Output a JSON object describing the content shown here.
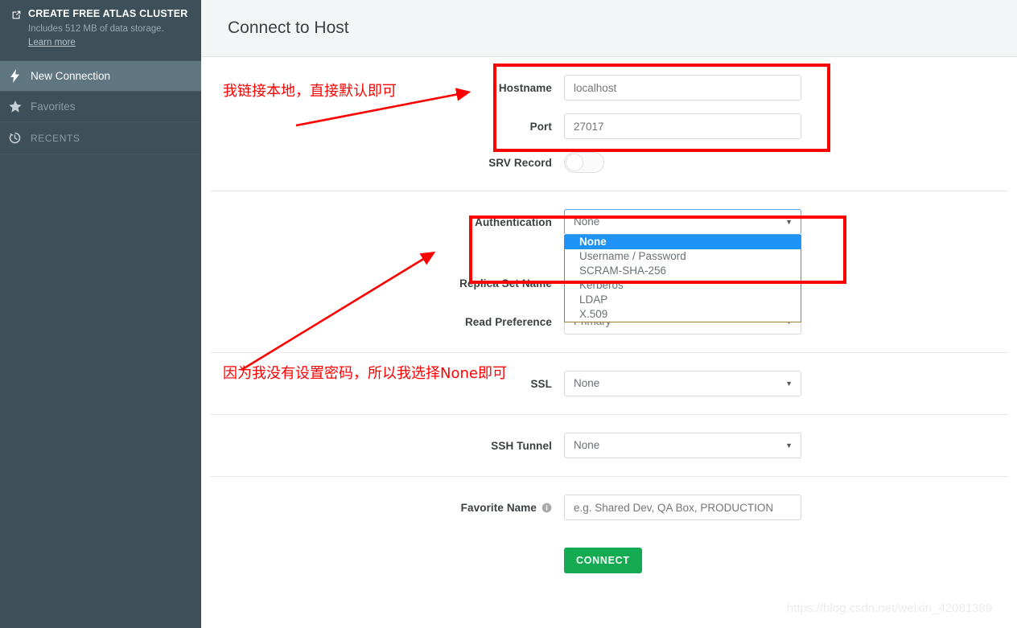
{
  "sidebar": {
    "promo": {
      "icon": "external-link-icon",
      "title": "CREATE FREE ATLAS CLUSTER",
      "subtitle": "Includes 512 MB of data storage.",
      "link": "Learn more"
    },
    "items": [
      {
        "icon": "lightning-bolt-icon",
        "label": "New Connection",
        "active": true
      },
      {
        "icon": "star-icon",
        "label": "Favorites",
        "active": false
      },
      {
        "icon": "history-clock-icon",
        "label": "RECENTS",
        "active": false
      }
    ]
  },
  "header": {
    "title": "Connect to Host"
  },
  "form": {
    "hostname": {
      "label": "Hostname",
      "placeholder": "localhost",
      "value": ""
    },
    "port": {
      "label": "Port",
      "placeholder": "27017",
      "value": ""
    },
    "srv_record": {
      "label": "SRV Record",
      "state": "off"
    },
    "authentication": {
      "label": "Authentication",
      "value": "None",
      "open": true,
      "options": [
        "None",
        "Username / Password",
        "SCRAM-SHA-256",
        "Kerberos",
        "LDAP",
        "X.509"
      ],
      "selected_option": "None"
    },
    "replica_set_name": {
      "label": "Replica Set Name",
      "placeholder": "",
      "value": ""
    },
    "read_preference": {
      "label": "Read Preference",
      "value": "Primary"
    },
    "ssl": {
      "label": "SSL",
      "value": "None"
    },
    "ssh_tunnel": {
      "label": "SSH Tunnel",
      "value": "None"
    },
    "favorite_name": {
      "label": "Favorite Name",
      "info_icon": "info-circle-icon",
      "placeholder": "e.g. Shared Dev, QA Box, PRODUCTION",
      "value": ""
    },
    "connect_button": "CONNECT"
  },
  "annotations": {
    "note_top": "我链接本地，直接默认即可",
    "note_bottom": "因为我没有设置密码，所以我选择None即可"
  },
  "watermark": "https://blog.csdn.net/weixin_42081389",
  "colors": {
    "sidebar_bg": "#3d4f58",
    "sidebar_active": "#607680",
    "header_bg": "#f4f5f6",
    "connect_green": "#13aa52",
    "highlight_blue": "#1f92f5",
    "annotation_red": "#fd0000",
    "dropdown_border": "#9a8233"
  }
}
